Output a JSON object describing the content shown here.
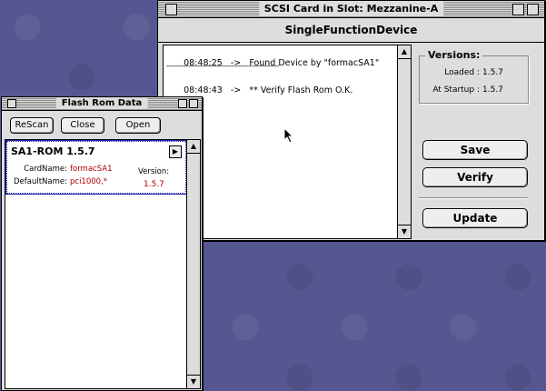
{
  "scsi_window": {
    "title": "SCSI Card in Slot: Mezzanine-A",
    "subtitle": "SingleFunctionDevice",
    "log": [
      {
        "time": "08:48:25",
        "arrow": "->",
        "message": "Found Device by \"formacSA1\""
      },
      {
        "separator": "----------------------------------------------------"
      },
      {
        "time": "08:48:43",
        "arrow": "->",
        "message": "** Verify Flash Rom O.K."
      }
    ],
    "versions": {
      "heading": "Versions:",
      "loaded_label": "Loaded :",
      "loaded_value": "1.5.7",
      "startup_label": "At Startup :",
      "startup_value": "1.5.7"
    },
    "buttons": {
      "save": "Save",
      "verify": "Verify",
      "update": "Update"
    }
  },
  "flash_window": {
    "title": "Flash Rom Data",
    "buttons": {
      "rescan": "ReScan",
      "close": "Close",
      "open": "Open"
    },
    "rom_item": {
      "title": "SA1-ROM 1.5.7",
      "cardname_label": "CardName:",
      "cardname_value": "formacSA1",
      "defaultname_label": "DefaultName:",
      "defaultname_value": "pci1000,*",
      "version_label": "Version:",
      "version_value": "1.5.7"
    }
  },
  "colors": {
    "desktop": "#565691",
    "highlight_red": "#b00000",
    "selection_blue": "#2222aa"
  }
}
